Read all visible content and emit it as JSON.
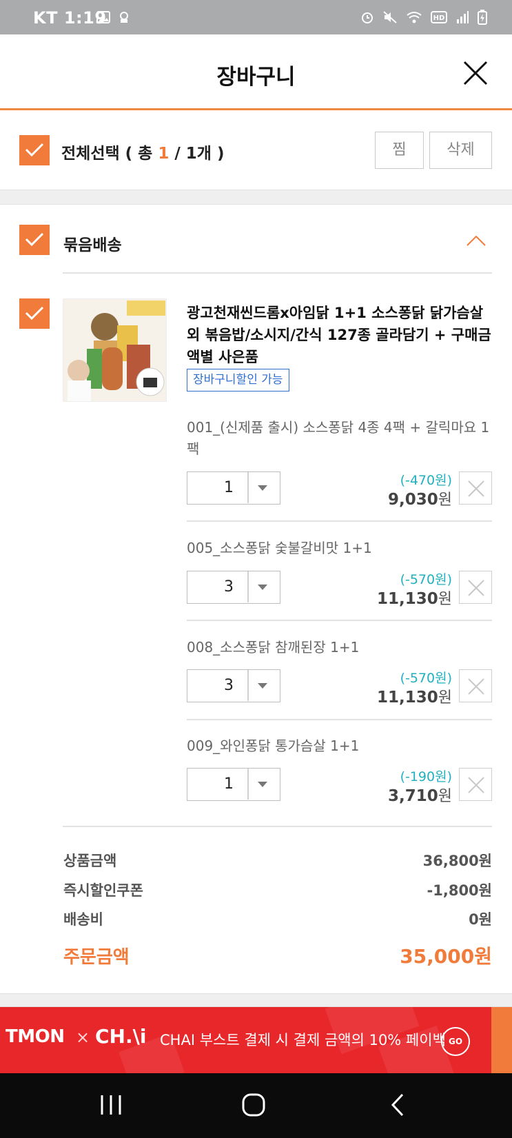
{
  "status_bar": {
    "time": "KT 1:19",
    "icons": [
      "image-icon",
      "app-icon",
      "alarm-icon",
      "mute-icon",
      "wifi-icon",
      "hd-icon",
      "signal-icon",
      "battery-icon"
    ]
  },
  "header": {
    "title": "장바구니",
    "close_icon": "close-icon"
  },
  "select_all": {
    "label_prefix": "전체선택 ( 총 ",
    "selected": "1",
    "label_suffix": " / 1개 )",
    "wish_button": "찜",
    "delete_button": "삭제"
  },
  "bundle": {
    "label": "묶음배송",
    "collapse_icon": "chevron-up-icon"
  },
  "product": {
    "title": "광고천재씬드롬x아임닭 1+1 소스퐁닭 닭가슴살 외 볶음밥/소시지/간식 127종 골라담기 + 구매금액별 사은품",
    "badge": "장바구니할인 가능",
    "options": [
      {
        "name": "001_(신제품 출시) 소스퐁닭 4종 4팩 + 갈릭마요 1팩",
        "qty": "1",
        "discount": "(-470원)",
        "price": "9,030",
        "unit": "원"
      },
      {
        "name": "005_소스퐁닭 숯불갈비맛 1+1",
        "qty": "3",
        "discount": "(-570원)",
        "price": "11,130",
        "unit": "원"
      },
      {
        "name": "008_소스퐁닭 참깨된장 1+1",
        "qty": "3",
        "discount": "(-570원)",
        "price": "11,130",
        "unit": "원"
      },
      {
        "name": "009_와인퐁닭 통가슴살 1+1",
        "qty": "1",
        "discount": "(-190원)",
        "price": "3,710",
        "unit": "원"
      }
    ]
  },
  "summary": {
    "items": [
      {
        "label": "상품금액",
        "value": "36,800원"
      },
      {
        "label": "즉시할인쿠폰",
        "value": "-1,800원"
      },
      {
        "label": "배송비",
        "value": "0원"
      }
    ],
    "total_label": "주문금액",
    "total_value": "35,000원"
  },
  "banner": {
    "tmon": "TMON",
    "x": "×",
    "chai": "CH.\\i",
    "message": "CHAI 부스트 결제 시 결제 금액의 10% 페이백",
    "go": "GO"
  },
  "colors": {
    "accent": "#f07b3a",
    "discount": "#20b0c0",
    "badge": "#2f6fd0",
    "banner": "#e8272b"
  }
}
